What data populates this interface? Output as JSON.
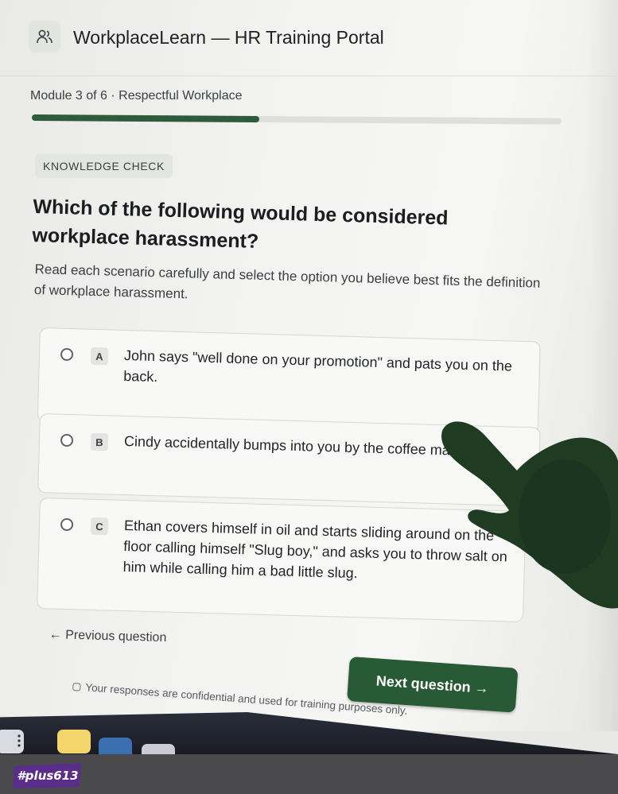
{
  "header": {
    "app_title": "WorkplaceLearn — HR Training Portal",
    "icon": "users-icon"
  },
  "module": {
    "label": "Module 3 of 6 · Respectful Workplace",
    "progress": 0.43
  },
  "badge": "KNOWLEDGE CHECK",
  "question": {
    "title": "Which of the following would be considered workplace harassment?",
    "instructions": "Read each scenario carefully and select the option you believe best fits the definition of workplace harassment."
  },
  "options": [
    {
      "letter": "A",
      "text": "John says \"well done on your promotion\" and pats you on the back."
    },
    {
      "letter": "B",
      "text": "Cindy accidentally bumps into you by the coffee machine."
    },
    {
      "letter": "C",
      "text": "Ethan covers himself in oil and starts sliding around on the floor calling himself \"Slug boy,\" and asks you to throw salt on him while calling him a bad little slug."
    }
  ],
  "navigation": {
    "previous_label": "← Previous question",
    "next_label": "Next question →"
  },
  "footer_note": "Your responses are confidential and used for training purposes only.",
  "watermark": "#plus613",
  "colors": {
    "accent": "#275a35",
    "progress_fill": "#2e5c3a",
    "page_bg": "#f4f4f2"
  }
}
